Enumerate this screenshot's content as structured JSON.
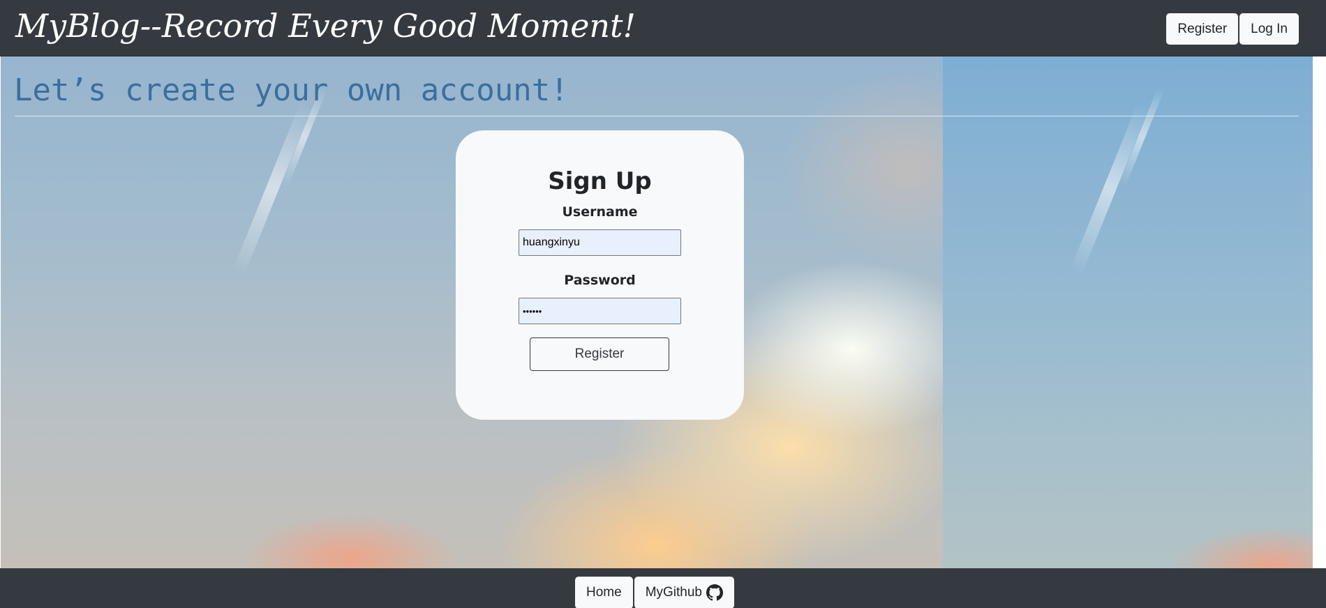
{
  "header": {
    "brand": "MyBlog--Record Every Good Moment!",
    "register_label": "Register",
    "login_label": "Log In"
  },
  "main": {
    "heading": "Let’s create your own account!",
    "form": {
      "title": "Sign Up",
      "username_label": "Username",
      "username_value": "huangxinyu",
      "password_label": "Password",
      "password_value": "123456",
      "submit_label": "Register"
    }
  },
  "footer": {
    "home_label": "Home",
    "github_label": "MyGithub",
    "github_icon": "github-icon"
  },
  "colors": {
    "navbar": "#343a40",
    "heading_text": "#3a6f9e",
    "card_bg": "#f8f9fa",
    "input_bg": "#e8f0fe"
  }
}
